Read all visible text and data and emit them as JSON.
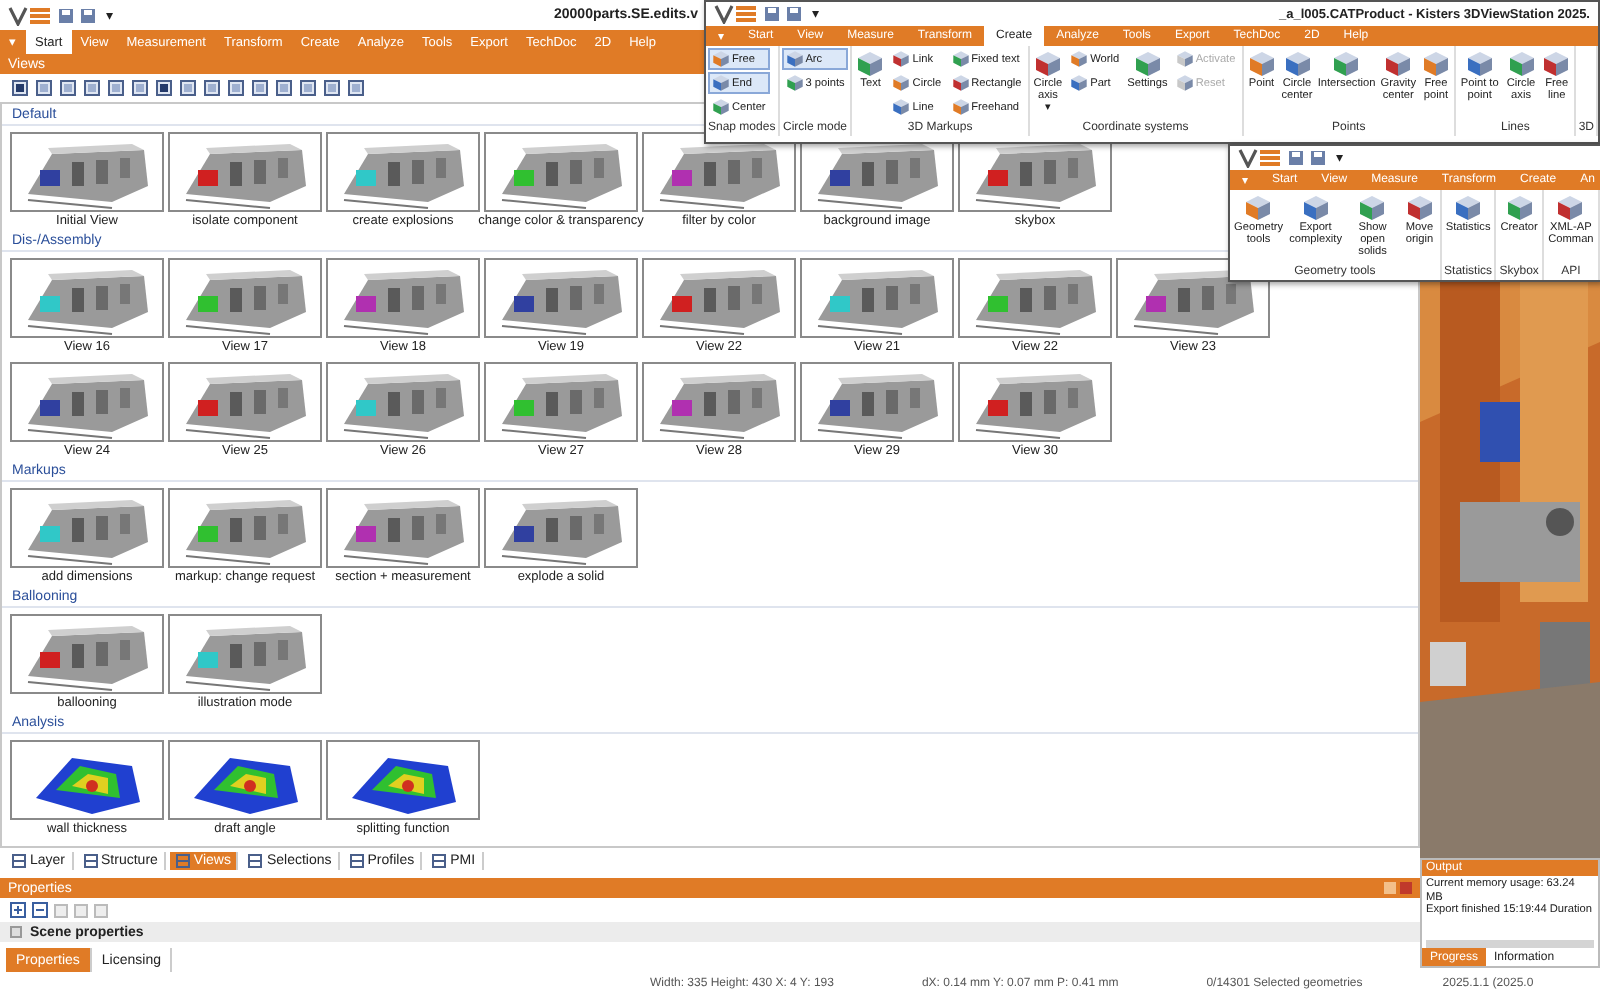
{
  "app": {
    "quick_menu": "▾",
    "title": "20000parts.SE.edits.v",
    "menu": [
      {
        "label": "▾",
        "selected": false
      },
      {
        "label": "Start",
        "selected": true
      },
      {
        "label": "View",
        "selected": false
      },
      {
        "label": "Measurement",
        "selected": false
      },
      {
        "label": "Transform",
        "selected": false
      },
      {
        "label": "Create",
        "selected": false
      },
      {
        "label": "Analyze",
        "selected": false
      },
      {
        "label": "Tools",
        "selected": false
      },
      {
        "label": "Export",
        "selected": false
      },
      {
        "label": "TechDoc",
        "selected": false
      },
      {
        "label": "2D",
        "selected": false
      },
      {
        "label": "Help",
        "selected": false
      }
    ],
    "ribbon_label": "Views"
  },
  "gallery": [
    {
      "title": "Default",
      "rows": [
        [
          "Initial View",
          "isolate component",
          "create explosions",
          "change color & transparency",
          "filter by color",
          "background image",
          "skybox"
        ]
      ]
    },
    {
      "title": "Dis-/Assembly",
      "rows": [
        [
          "View 16",
          "View 17",
          "View 18",
          "View 19",
          "View 22",
          "View 21",
          "View 22",
          "View 23"
        ],
        [
          "View 24",
          "View 25",
          "View 26",
          "View 27",
          "View 28",
          "View 29",
          "View 30"
        ]
      ]
    },
    {
      "title": "Markups",
      "rows": [
        [
          "add dimensions",
          "markup: change request",
          "section + measurement",
          "explode a solid"
        ]
      ]
    },
    {
      "title": "Ballooning",
      "rows": [
        [
          "ballooning",
          "illustration mode"
        ]
      ]
    },
    {
      "title": "Analysis",
      "rows": [
        [
          "wall thickness",
          "draft angle",
          "splitting function"
        ]
      ]
    }
  ],
  "bottom_tabs": [
    {
      "label": "Layer",
      "selected": false
    },
    {
      "label": "Structure",
      "selected": false
    },
    {
      "label": "Views",
      "selected": true
    },
    {
      "label": "Selections",
      "selected": false
    },
    {
      "label": "Profiles",
      "selected": false
    },
    {
      "label": "PMI",
      "selected": false
    }
  ],
  "properties": {
    "title": "Properties",
    "section": "Scene properties",
    "tabs": [
      {
        "label": "Properties",
        "selected": true
      },
      {
        "label": "Licensing",
        "selected": false
      }
    ]
  },
  "output": {
    "title": "Output",
    "lines": [
      "Current memory usage: 63.24 MB",
      "Export finished 15:19:44 Duration"
    ],
    "tabs": [
      {
        "label": "Progress",
        "selected": true
      },
      {
        "label": "Information",
        "selected": false
      }
    ]
  },
  "status_bar": [
    "Width: 335 Height: 430 X: 4 Y: 193",
    "dX: 0.14 mm Y: 0.07 mm P: 0.41 mm",
    "0/14301 Selected geometries",
    "2025.1.1 (2025.0"
  ],
  "overlay_windows": [
    {
      "quick_menu": "▾",
      "title": "_a_l005.CATProduct - Kisters 3DViewStation 2025.",
      "tabs": [
        {
          "label": "▾",
          "selected": false
        },
        {
          "label": "Start",
          "selected": false
        },
        {
          "label": "View",
          "selected": false
        },
        {
          "label": "Measure",
          "selected": false
        },
        {
          "label": "Transform",
          "selected": false
        },
        {
          "label": "Create",
          "selected": true
        },
        {
          "label": "Analyze",
          "selected": false
        },
        {
          "label": "Tools",
          "selected": false
        },
        {
          "label": "Export",
          "selected": false
        },
        {
          "label": "TechDoc",
          "selected": false
        },
        {
          "label": "2D",
          "selected": false
        },
        {
          "label": "Help",
          "selected": false
        }
      ],
      "groups": [
        {
          "name": "Snap modes",
          "tools": [
            {
              "label": "Free",
              "kind": "small",
              "selected": true
            },
            {
              "label": "End",
              "kind": "small",
              "selected": true
            },
            {
              "label": "Center",
              "kind": "small",
              "selected": false
            }
          ]
        },
        {
          "name": "Circle mode",
          "tools": [
            {
              "label": "Arc",
              "kind": "small",
              "selected": true
            },
            {
              "label": "3 points",
              "kind": "small",
              "selected": false
            }
          ]
        },
        {
          "name": "3D Markups",
          "tools": [
            {
              "label": "Text",
              "kind": "large"
            },
            {
              "label": "Link",
              "kind": "small"
            },
            {
              "label": "Circle",
              "kind": "small"
            },
            {
              "label": "Line",
              "kind": "small"
            },
            {
              "label": "Fixed text",
              "kind": "small"
            },
            {
              "label": "Rectangle",
              "kind": "small"
            },
            {
              "label": "Freehand",
              "kind": "small"
            }
          ]
        },
        {
          "name": "Coordinate systems",
          "tools": [
            {
              "label": "Circle axis ▾",
              "kind": "large",
              "disabled": false
            },
            {
              "label": "World",
              "kind": "small",
              "disabled": false
            },
            {
              "label": "Part",
              "kind": "small",
              "disabled": false
            },
            {
              "label": "Settings",
              "kind": "large",
              "disabled": false
            },
            {
              "label": "Activate",
              "kind": "small",
              "disabled": true
            },
            {
              "label": "Reset",
              "kind": "small",
              "disabled": true
            }
          ]
        },
        {
          "name": "Points",
          "tools": [
            {
              "label": "Point",
              "kind": "large"
            },
            {
              "label": "Circle center",
              "kind": "large"
            },
            {
              "label": "Intersection",
              "kind": "large"
            },
            {
              "label": "Gravity center",
              "kind": "large"
            },
            {
              "label": "Free point",
              "kind": "large"
            }
          ]
        },
        {
          "name": "Lines",
          "tools": [
            {
              "label": "Point to point",
              "kind": "large"
            },
            {
              "label": "Circle axis",
              "kind": "large"
            },
            {
              "label": "Free line",
              "kind": "large"
            }
          ]
        },
        {
          "name": "3D"
        }
      ]
    },
    {
      "quick_menu": "▾",
      "tabs": [
        {
          "label": "▾",
          "selected": false
        },
        {
          "label": "Start",
          "selected": false
        },
        {
          "label": "View",
          "selected": false
        },
        {
          "label": "Measure",
          "selected": false
        },
        {
          "label": "Transform",
          "selected": false
        },
        {
          "label": "Create",
          "selected": false
        },
        {
          "label": "An",
          "selected": false
        }
      ],
      "groups": [
        {
          "name": "Geometry tools",
          "tools": [
            {
              "label": "Geometry tools",
              "kind": "large"
            },
            {
              "label": "Export complexity",
              "kind": "large"
            },
            {
              "label": "Show open solids",
              "kind": "large"
            },
            {
              "label": "Move origin",
              "kind": "large"
            }
          ]
        },
        {
          "name": "Statistics",
          "tools": [
            {
              "label": "Statistics",
              "kind": "large"
            }
          ]
        },
        {
          "name": "Skybox",
          "tools": [
            {
              "label": "Creator",
              "kind": "large"
            }
          ]
        },
        {
          "name": "API",
          "tools": [
            {
              "label": "XML-AP Comman",
              "kind": "large"
            }
          ]
        }
      ]
    }
  ]
}
